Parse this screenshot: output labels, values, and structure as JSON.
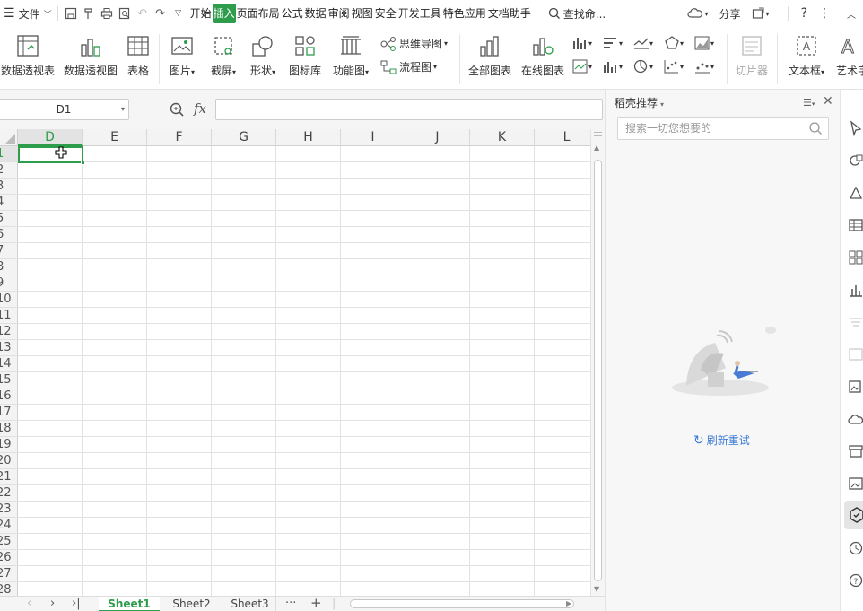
{
  "menubar": {
    "file_label": "文件",
    "tabs": [
      {
        "label": "开始",
        "active": false
      },
      {
        "label": "插入",
        "active": true
      },
      {
        "label": "页面布局",
        "active": false
      },
      {
        "label": "公式",
        "active": false
      },
      {
        "label": "数据",
        "active": false
      },
      {
        "label": "审阅",
        "active": false
      },
      {
        "label": "视图",
        "active": false
      },
      {
        "label": "安全",
        "active": false
      },
      {
        "label": "开发工具",
        "active": false
      },
      {
        "label": "特色应用",
        "active": false
      },
      {
        "label": "文档助手",
        "active": false
      }
    ],
    "search_label": "查找命...",
    "share_label": "分享"
  },
  "ribbon": {
    "pivot_table": "数据透视表",
    "pivot_chart": "数据透视图",
    "table": "表格",
    "picture": "图片",
    "screenshot": "截屏",
    "shape": "形状",
    "icon_library": "图标库",
    "function_chart": "功能图",
    "mind_map": "思维导图",
    "flowchart": "流程图",
    "all_charts": "全部图表",
    "online_chart": "在线图表",
    "slicer": "切片器",
    "textbox": "文本框",
    "art_text": "艺术字"
  },
  "formula_bar": {
    "name_box": "D1",
    "fx_label": "fx",
    "formula": ""
  },
  "grid": {
    "columns": [
      "D",
      "E",
      "F",
      "G",
      "H",
      "I",
      "J",
      "K",
      "L"
    ],
    "rows": [
      "1",
      "2",
      "3",
      "4",
      "5",
      "6",
      "7",
      "8",
      "9",
      "10",
      "11",
      "12",
      "13",
      "14",
      "15",
      "16",
      "17",
      "18",
      "19",
      "20",
      "21",
      "22",
      "23",
      "24",
      "25",
      "26",
      "27",
      "28"
    ],
    "active_cell": "D1"
  },
  "sheets": {
    "tabs": [
      "Sheet1",
      "Sheet2",
      "Sheet3"
    ],
    "active": "Sheet1",
    "more": "···",
    "add": "+"
  },
  "panel": {
    "title": "稻壳推荐",
    "search_placeholder": "搜索一切您想要的",
    "refresh_label": "刷新重试"
  },
  "colors": {
    "accent": "#2d9c4b",
    "link": "#3b7bd4"
  }
}
